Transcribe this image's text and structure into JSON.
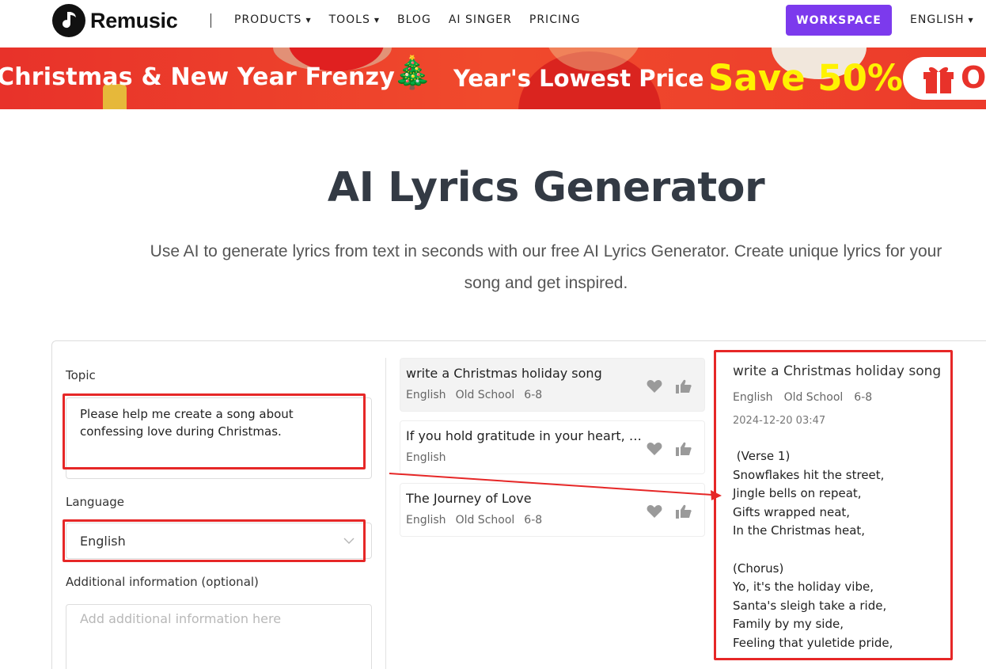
{
  "header": {
    "brand": "Remusic",
    "nav": [
      {
        "label": "PRODUCTS",
        "dropdown": true
      },
      {
        "label": "TOOLS",
        "dropdown": true
      },
      {
        "label": "BLOG",
        "dropdown": false
      },
      {
        "label": "AI SINGER",
        "dropdown": false
      },
      {
        "label": "PRICING",
        "dropdown": false
      }
    ],
    "workspace_label": "WORKSPACE",
    "language_label": "ENGLISH"
  },
  "banner": {
    "text_left": "Christmas & New Year Frenzy",
    "tree_glyph": "🎄",
    "text_middle": "Year's Lowest Price",
    "save_text": "Save 50%",
    "pill_text": "Op",
    "colors": {
      "background": "#e8322a",
      "save": "#fff200"
    }
  },
  "hero": {
    "title": "AI Lyrics Generator",
    "subtitle": "Use AI to generate lyrics from text in seconds with our free AI Lyrics Generator. Create unique lyrics for your song and get inspired."
  },
  "form": {
    "topic_label": "Topic",
    "topic_value": "Please help me create a song about confessing love during Christmas.",
    "language_label": "Language",
    "language_value": "English",
    "additional_label": "Additional information (optional)",
    "additional_placeholder": "Add additional information here"
  },
  "history": [
    {
      "title": "write a Christmas holiday song",
      "tags": [
        "English",
        "Old School",
        "6-8"
      ],
      "active": true
    },
    {
      "title": "If you hold gratitude in your heart, the...",
      "tags": [
        "English"
      ],
      "active": false
    },
    {
      "title": "The Journey of Love",
      "tags": [
        "English",
        "Old School",
        "6-8"
      ],
      "active": false
    }
  ],
  "result": {
    "title": "write a Christmas holiday song",
    "tags": [
      "English",
      "Old School",
      "6-8"
    ],
    "date": "2024-12-20 03:47",
    "lyrics": " (Verse 1)\nSnowflakes hit the street,\nJingle bells on repeat,\nGifts wrapped neat,\nIn the Christmas heat,\n\n(Chorus)\nYo, it's the holiday vibe,\nSanta's sleigh take a ride,\nFamily by my side,\nFeeling that yuletide pride,"
  },
  "colors": {
    "accent": "#7c3aed",
    "highlight_border": "#e62727"
  }
}
